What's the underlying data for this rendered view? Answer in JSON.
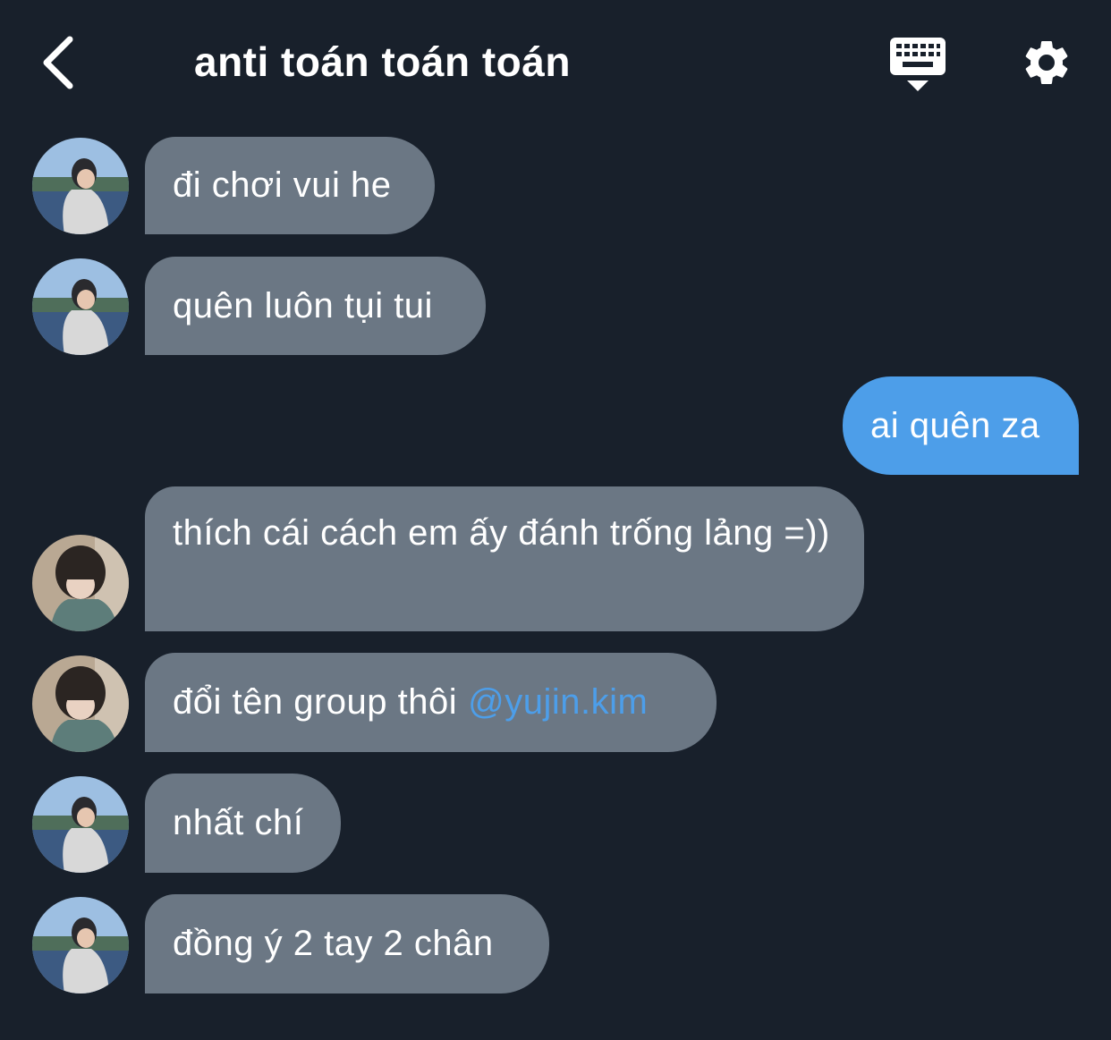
{
  "header": {
    "title": "anti toán toán toán"
  },
  "icons": {
    "back": "chevron-left-icon",
    "keyboard": "keyboard-icon",
    "settings": "gear-icon"
  },
  "colors": {
    "background": "#18202b",
    "incoming_bubble": "#6b7784",
    "outgoing_bubble": "#4d9ee9",
    "mention": "#4d9ee9"
  },
  "messages": [
    {
      "sender": "other",
      "avatar": "avatar-lake-boy",
      "text": "đi chơi vui he"
    },
    {
      "sender": "other",
      "avatar": "avatar-lake-boy",
      "text": "quên luôn tụi tui"
    },
    {
      "sender": "me",
      "text": "ai quên za"
    },
    {
      "sender": "other",
      "avatar": "avatar-dark-hair",
      "text": "thích cái cách em ấy đánh trống lảng =))"
    },
    {
      "sender": "other",
      "avatar": "avatar-dark-hair",
      "text": "đổi tên group thôi",
      "mention": "@yujin.kim"
    },
    {
      "sender": "other",
      "avatar": "avatar-lake-boy",
      "text": "nhất chí"
    },
    {
      "sender": "other",
      "avatar": "avatar-lake-boy",
      "text": "đồng ý 2 tay 2 chân"
    }
  ]
}
